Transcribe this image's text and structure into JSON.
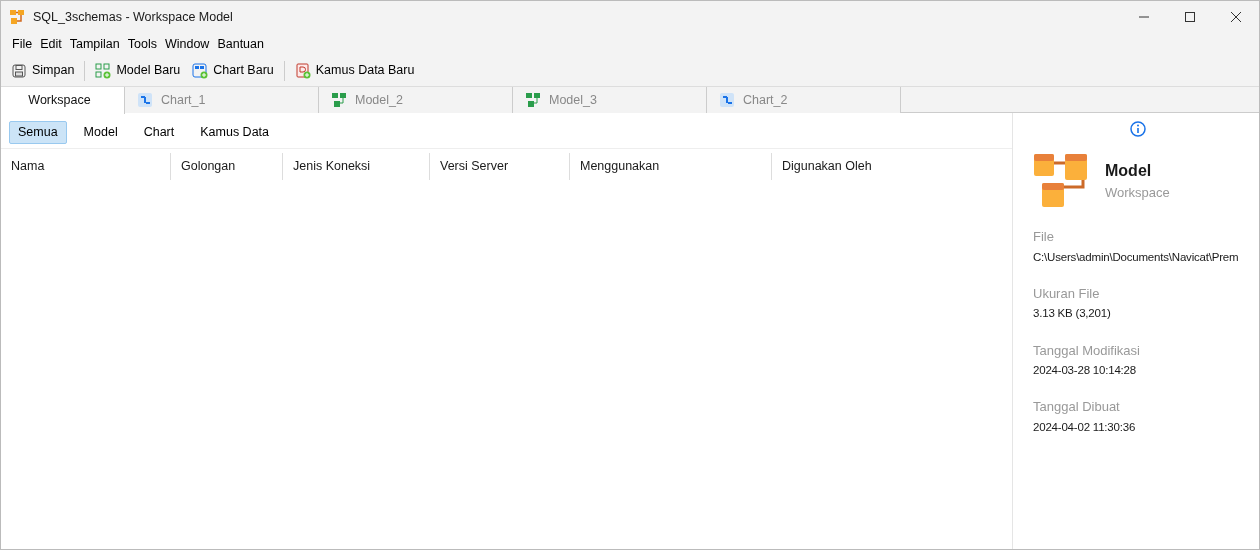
{
  "window": {
    "title": "SQL_3schemas - Workspace Model"
  },
  "menu": [
    "File",
    "Edit",
    "Tampilan",
    "Tools",
    "Window",
    "Bantuan"
  ],
  "toolbar": [
    {
      "label": "Simpan",
      "kind": "save"
    },
    {
      "label": "Model Baru",
      "kind": "model"
    },
    {
      "label": "Chart Baru",
      "kind": "chart"
    },
    {
      "label": "Kamus Data Baru",
      "kind": "dictionary"
    }
  ],
  "tabs": [
    {
      "label": "Workspace",
      "kind": "workspace",
      "selected": true
    },
    {
      "label": "Chart_1",
      "kind": "chart",
      "selected": false
    },
    {
      "label": "Model_2",
      "kind": "model",
      "selected": false
    },
    {
      "label": "Model_3",
      "kind": "model",
      "selected": false
    },
    {
      "label": "Chart_2",
      "kind": "chart",
      "selected": false
    }
  ],
  "filters": [
    {
      "label": "Semua",
      "selected": true
    },
    {
      "label": "Model",
      "selected": false
    },
    {
      "label": "Chart",
      "selected": false
    },
    {
      "label": "Kamus Data",
      "selected": false
    }
  ],
  "table": {
    "columns": [
      "Nama",
      "Golongan",
      "Jenis Koneksi",
      "Versi Server",
      "Menggunakan",
      "Digunakan Oleh"
    ]
  },
  "info": {
    "title": "Model",
    "subtitle": "Workspace",
    "fields": [
      {
        "label": "File",
        "value": "C:\\Users\\admin\\Documents\\Navicat\\Prem"
      },
      {
        "label": "Ukuran File",
        "value": "3.13 KB (3,201)"
      },
      {
        "label": "Tanggal Modifikasi",
        "value": "2024-03-28 10:14:28"
      },
      {
        "label": "Tanggal Dibuat",
        "value": "2024-04-02 11:30:36"
      }
    ]
  }
}
